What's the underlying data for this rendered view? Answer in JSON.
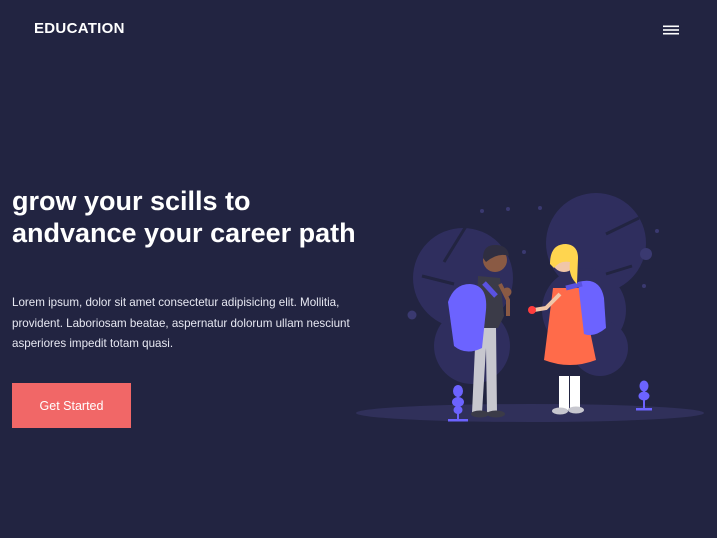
{
  "header": {
    "brand": "EDUCATION",
    "menu_icon": "hamburger-menu-icon"
  },
  "hero": {
    "title": "grow your scills to andvance your career path",
    "description": "Lorem ipsum, dolor sit amet consectetur adipisicing elit. Mollitia, provident. Laboriosam beatae, aspernatur dolorum ullam nesciunt asperiores impedit totam quasi.",
    "cta_label": "Get Started"
  },
  "colors": {
    "background": "#222441",
    "accent": "#f16767",
    "illustration_blob": "#2f2e5e",
    "illustration_purple": "#6c63ff"
  }
}
